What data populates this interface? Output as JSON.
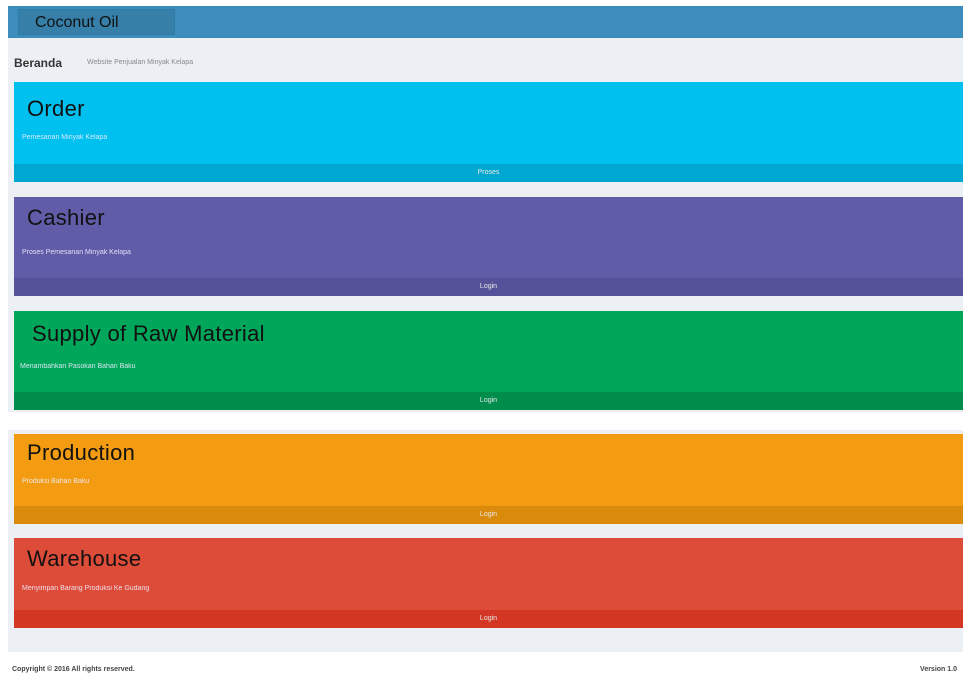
{
  "navbar": {
    "brand": "Coconut Oil",
    "brand_color": "#3c8dbc"
  },
  "header": {
    "title": "Beranda",
    "subtitle": "Website Penjualan Minyak Kelapa"
  },
  "boxes": [
    {
      "title": "Order",
      "description": "Pemesanan Minyak Kelapa",
      "action": "Proses",
      "color": "#00c0ef",
      "footer_color": "#00a7d0"
    },
    {
      "title": "Cashier",
      "description": "Proses Pemesanan Minyak Kelapa",
      "action": "Login",
      "color": "#605ca8",
      "footer_color": "#555299"
    },
    {
      "title": "Supply of Raw Material",
      "description": "Menambahkan Pasokan Bahan Baku",
      "action": "Login",
      "color": "#00a65a",
      "footer_color": "#008d4c"
    },
    {
      "title": "Production",
      "description": "Produksi Bahan Baku",
      "action": "Login",
      "color": "#f39c12",
      "footer_color": "#db8b0b"
    },
    {
      "title": "Warehouse",
      "description": "Menyimpan Barang Produksi Ke Gudang",
      "action": "Login",
      "color": "#dd4b39",
      "footer_color": "#d33724"
    }
  ],
  "footer": {
    "copyright": "Copyright © 2016 All rights reserved.",
    "version": "Version 1.0"
  }
}
